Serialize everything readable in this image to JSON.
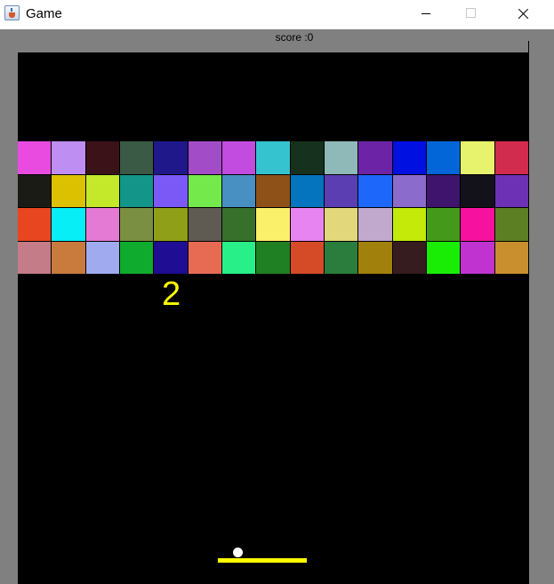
{
  "window": {
    "title": "Game",
    "icon": "java-cup-icon",
    "controls": [
      "minimize-icon",
      "maximize-icon",
      "close-icon"
    ]
  },
  "game": {
    "score_label": "score :0",
    "counter": "2",
    "colors": {
      "background": "#000000",
      "frame": "#808080",
      "paddle": "#ffff00",
      "ball": "#ffffff",
      "counter": "#ffff00"
    }
  },
  "bricks": {
    "rows": 4,
    "cols": 15,
    "colors": [
      [
        "#e94be1",
        "#bf8ef2",
        "#3a1218",
        "#3a5a46",
        "#1e188a",
        "#a24cc7",
        "#c24be0",
        "#35c3d0",
        "#16311d",
        "#8fb9b8",
        "#6d23a6",
        "#0010e0",
        "#0366d8",
        "#e7f26d",
        "#d12b4e"
      ],
      [
        "#1b1b16",
        "#dcc100",
        "#c4e92a",
        "#139689",
        "#7a59f7",
        "#74e94c",
        "#4890c2",
        "#8e5118",
        "#0574be",
        "#5b3eb2",
        "#1e67fb",
        "#8b6bcb",
        "#3e146d",
        "#13121b",
        "#6d31b5"
      ],
      [
        "#e84621",
        "#07eef7",
        "#e47ad3",
        "#7a8f41",
        "#8f9f18",
        "#5f5a52",
        "#36702b",
        "#fbf06a",
        "#e883f2",
        "#e2d77a",
        "#c0a9cc",
        "#c4ea0a",
        "#44991b",
        "#f6129f",
        "#5b7f22"
      ],
      [
        "#c47c88",
        "#c87b3c",
        "#9fabee",
        "#0fab2e",
        "#1f0d93",
        "#e76b53",
        "#29ef88",
        "#1f7f23",
        "#d54b28",
        "#2a7d3c",
        "#a1810b",
        "#371c1f",
        "#19ed05",
        "#c133d0",
        "#c98f2e"
      ]
    ]
  }
}
